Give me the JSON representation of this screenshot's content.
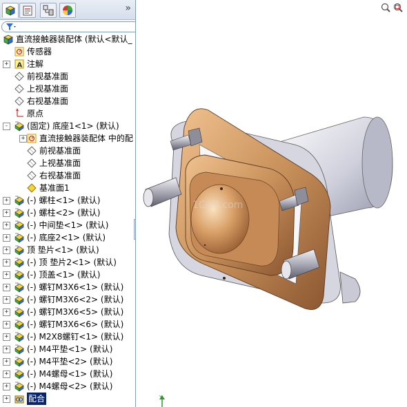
{
  "panel": {
    "filter_icon": "filter-icon",
    "collapse_symbol": "»"
  },
  "tree": {
    "root": "直流接触器装配体 (默认<默认_",
    "sensors": "传感器",
    "annotations": "注解",
    "front_plane": "前视基准面",
    "top_plane": "上视基准面",
    "right_plane": "右视基准面",
    "origin": "原点",
    "base": "(固定) 底座1<1> (默认)",
    "base_children": [
      "直流接触器装配体 中的配",
      "前视基准面",
      "上视基准面",
      "右视基准面",
      "基准面1"
    ],
    "components": [
      "(-) 螺柱<1> (默认)",
      "(-) 螺柱<2> (默认)",
      "(-) 中间垫<1> (默认)",
      "(-) 底座2<1> (默认)",
      "顶 垫片<1> (默认)",
      "(-) 顶 垫片2<1> (默认)",
      "(-) 顶盖<1> (默认)",
      "(-) 螺钉M3X6<1> (默认)",
      "(-) 螺钉M3X6<2> (默认)",
      "(-) 螺钉M3X6<5> (默认)",
      "(-) 螺钉M3X6<6> (默认)",
      "(-) M2X8螺钉<1> (默认)",
      "(-) M4平垫<1> (默认)",
      "(-) M4平垫<2> (默认)",
      "(-) M4螺母<1> (默认)",
      "(-) M4螺母<2> (默认)"
    ],
    "mates": "配合"
  },
  "viewport": {
    "watermark": "1CAD.com",
    "triad_label": "Y"
  },
  "colors": {
    "copper": "#c8905a",
    "steel": "#c9cbd6",
    "selection": "#0a246a"
  }
}
